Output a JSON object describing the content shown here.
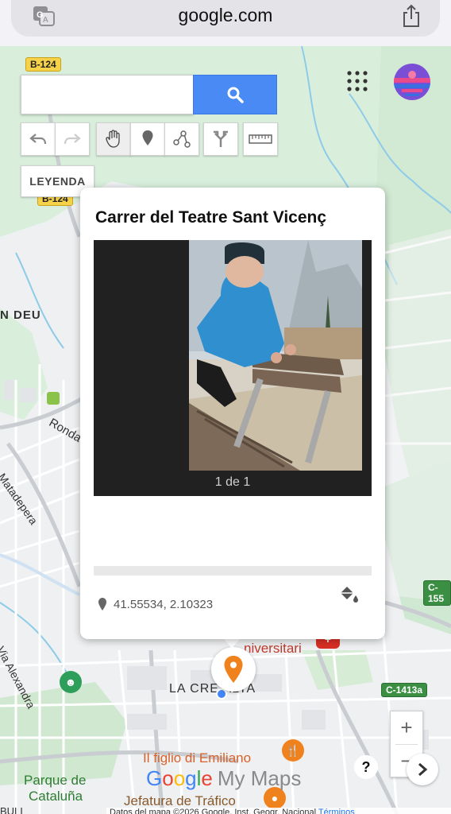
{
  "browser": {
    "url": "google.com",
    "translate_icon": "translate-icon",
    "share_icon": "share-icon"
  },
  "search": {
    "value": "",
    "placeholder": "",
    "button_icon": "search-icon"
  },
  "toolbar": {
    "tools": [
      "undo-icon",
      "redo-icon",
      "hand-icon",
      "marker-icon",
      "line-icon",
      "directions-icon",
      "ruler-icon"
    ],
    "legend_label": "LEYENDA"
  },
  "header": {
    "apps_icon": "apps-grid-icon",
    "avatar": "avatar"
  },
  "map": {
    "labels": {
      "road_b124_top": "B-124",
      "road_b124_mid": "B-124",
      "road_c155": "C-155",
      "road_c1413a": "C-1413a",
      "neighborhood_deu": "N DEU",
      "ronda": "Ronda",
      "matadepera": "de Matadepera",
      "via_alexandra": "Via Alexandra",
      "universitari": "niversitari",
      "la_creu_alta": "LA CRE   ALTA",
      "il_figlio": "Il figlio di Emiliano",
      "jefatura": "Jefatura de Tráfico",
      "parque": "Parque de",
      "cataluna": "Cataluña",
      "bul": "BULI"
    }
  },
  "card": {
    "title": "Carrer del Teatre Sant Vicenç",
    "photo_counter": "1 de 1",
    "coordinates": "41.55534, 2.10323",
    "coord_icon": "location-pin-icon",
    "style_icon": "paint-bucket-icon"
  },
  "controls": {
    "zoom_in": "+",
    "zoom_out": "−",
    "help": "?",
    "next_icon": "chevron-right-icon"
  },
  "brand": {
    "google": [
      "G",
      "o",
      "o",
      "g",
      "l",
      "e"
    ],
    "product": "My Maps"
  },
  "attribution": {
    "text": "Datos del mapa ©2026 Google, Inst. Geogr. Nacional",
    "link": "Términos"
  },
  "colors": {
    "search_button": "#4a8af4",
    "marker": "#f0821e",
    "road_shield_yellow": "#f6d24a",
    "road_shield_green": "#3a8f43"
  }
}
